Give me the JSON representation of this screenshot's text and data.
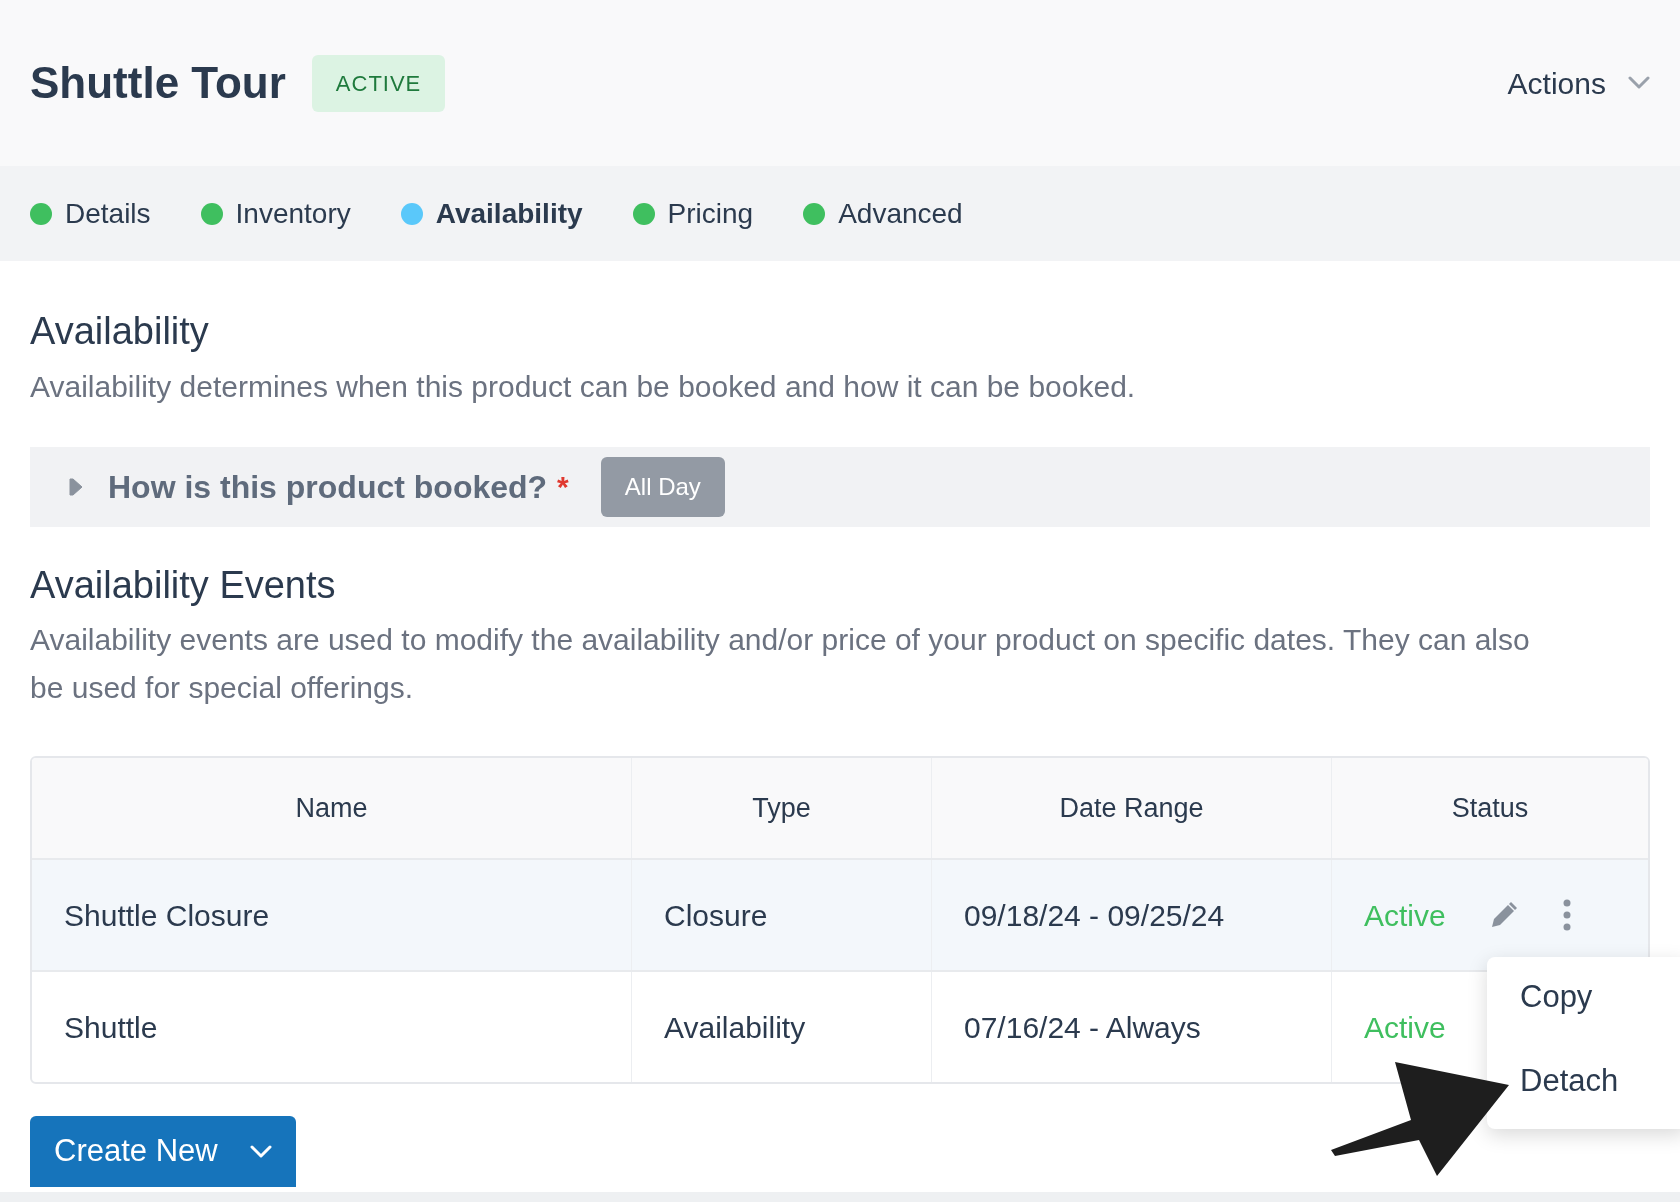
{
  "header": {
    "title": "Shuttle Tour",
    "status_badge": "ACTIVE",
    "actions": "Actions"
  },
  "tabs": [
    {
      "label": "Details",
      "selected": false,
      "color": "#3fbf5f"
    },
    {
      "label": "Inventory",
      "selected": false,
      "color": "#3fbf5f"
    },
    {
      "label": "Availability",
      "selected": true,
      "color": "#5ac8fa"
    },
    {
      "label": "Pricing",
      "selected": false,
      "color": "#3fbf5f"
    },
    {
      "label": "Advanced",
      "selected": false,
      "color": "#3fbf5f"
    }
  ],
  "availability": {
    "heading": "Availability",
    "description": "Availability determines when this product can be booked and how it can be booked.",
    "booking": {
      "question": "How is this product booked?",
      "required_mark": "*",
      "value": "All Day",
      "expanded": false
    }
  },
  "events": {
    "heading": "Availability Events",
    "description": "Availability events are used to modify the availability and/or price of your product on specific dates. They can also be used for special offerings.",
    "table": {
      "columns": [
        "Name",
        "Type",
        "Date Range",
        "Status"
      ],
      "rows": [
        {
          "name": "Shuttle Closure",
          "type": "Closure",
          "date_range": "09/18/24 - 09/25/24",
          "status": "Active",
          "selected": true
        },
        {
          "name": "Shuttle",
          "type": "Availability",
          "date_range": "07/16/24 - Always",
          "status": "Active",
          "selected": false
        }
      ]
    },
    "row_menu": [
      "Copy",
      "Detach"
    ],
    "create_button": "Create New"
  }
}
